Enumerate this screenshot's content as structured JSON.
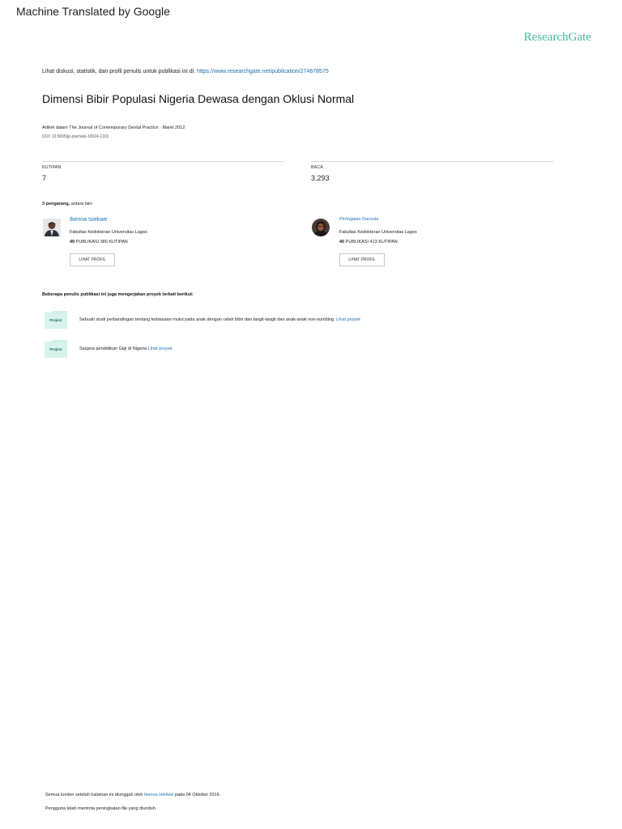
{
  "banner": "Machine Translated by Google",
  "brand": "ResearchGate",
  "view_line": {
    "prefix": "Lihat diskusi, statistik, dan profil penulis untuk publikasi ini di:",
    "url": "https://www.researchgate.net/publication/274678575"
  },
  "title": "Dimensi Bibir Populasi Nigeria Dewasa dengan Oklusi Normal",
  "article": {
    "label": "Artikel",
    "journal_text": " dalam The Journal of Contemporary Dental Practice · Maret 2012",
    "doi": "DOI: 10.5005/jp-journals-10024-1119"
  },
  "stats": [
    {
      "label": "KUTIPAN",
      "value": "7"
    },
    {
      "label": "BACA",
      "value": "3.293"
    }
  ],
  "authors_heading": {
    "bold": "3 pengarang,",
    "rest": " antara lain:"
  },
  "authors": [
    {
      "name": "Ikenna Isiekwe",
      "institution": "Fakultas Kedokteran Universitas Lagos",
      "pub_count": "49",
      "stats_rest": " PUBLIKASI 380 KUTIPAN",
      "button": "LIHAT PROFIL"
    },
    {
      "name": "Peringatan Dacosta",
      "institution": "Fakultas Kedokteran Universitas Lagos",
      "pub_count": "40",
      "stats_rest": " PUBLIKASI 413 KUTIPAN",
      "button": "LIHAT PROFIL"
    }
  ],
  "projects_heading": "Beberapa penulis publikasi ini juga mengerjakan proyek terkait berikut:",
  "projects": [
    {
      "badge": "Project",
      "text": "Sebuah studi perbandingan tentang kebiasaan mulut pada anak dengan celah bibir dan langit-langit dan anak-anak non-sumbing.",
      "link": "Lihat proyek"
    },
    {
      "badge": "Project",
      "text": "Sarjana pendidikan Gigi di Nigeria",
      "link": "Lihat proyek"
    }
  ],
  "footer": {
    "line1_prefix": "Semua konten setelah halaman ini diunggah oleh ",
    "line1_name": "Ikenna Isiekwe",
    "line1_suffix": " pada 04 Oktober 2016.",
    "line2": "Pengguna telah meminta peningkatan file yang diunduh."
  },
  "colors": {
    "brand": "#40ba9b",
    "link": "#1a6fb0",
    "folder": "#cdeee6"
  }
}
